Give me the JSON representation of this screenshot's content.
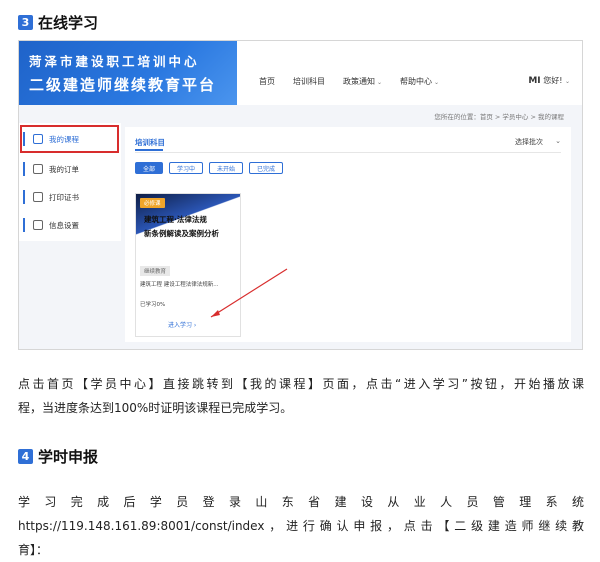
{
  "section3": {
    "number": "3",
    "title": "在线学习"
  },
  "screenshot": {
    "logo": {
      "line1": "菏泽市建设职工培训中心",
      "line2": "二级建造师继续教育平台"
    },
    "nav": [
      {
        "label": "首页",
        "dropdown": false
      },
      {
        "label": "培训科目",
        "dropdown": false
      },
      {
        "label": "政策通知",
        "dropdown": true
      },
      {
        "label": "帮助中心",
        "dropdown": true
      }
    ],
    "user": {
      "name": "MI",
      "greeting": "您好!"
    },
    "breadcrumb": "您所在的位置：首页 > 学员中心 > 我的课程",
    "sidebar": [
      {
        "label": "我的课程"
      },
      {
        "label": "我的订单"
      },
      {
        "label": "打印证书"
      },
      {
        "label": "信息设置"
      }
    ],
    "tab_title": "培训科目",
    "select_label": "选择批次",
    "filters": [
      "全部",
      "学习中",
      "未开始",
      "已完成"
    ],
    "course": {
      "tag": "必修课",
      "title_line1": "建筑工程·法律法规",
      "title_line2": "新条例解读及案例分析",
      "badge": "继续教育",
      "course_line": "建筑工程 建设工程法律法规新...",
      "progress_text": "已学习0%",
      "enter_label": "进入学习 ›"
    },
    "arrow_color": "#d82d2d",
    "accent_color": "#2f6fd6"
  },
  "paragraph1": {
    "line1": "点击首页【学员中心】直接跳转到【我的课程】页面，点击“进入学习”按钮，开始播放课",
    "line2": "程，当进度条达到100%时证明该课程已完成学习。"
  },
  "section4": {
    "number": "4",
    "title": "学时申报"
  },
  "paragraph2": {
    "line1": "学习完成后学员登录山东省建设从业人员管理系统",
    "line2": "https://119.148.161.89:8001/const/index，进行确认申报，点击【二级建造师继续教",
    "line3": "育】："
  }
}
